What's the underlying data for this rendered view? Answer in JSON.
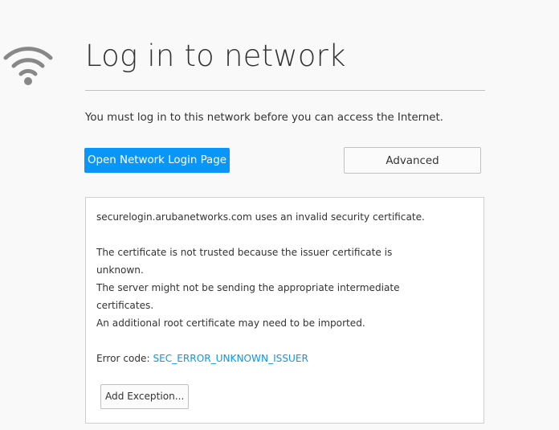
{
  "page": {
    "title": "Log in to network",
    "description": "You must log in to this network before you can access the Internet.",
    "icon": "wifi-icon"
  },
  "actions": {
    "primary_label": "Open Network Login Page",
    "secondary_label": "Advanced"
  },
  "details": {
    "invalid_cert": "securelogin.arubanetworks.com uses an invalid security certificate.",
    "not_trusted_1": "The certificate is not trusted because the issuer certificate is",
    "not_trusted_2": "unknown.",
    "intermediate_1": "The server might not be sending the appropriate intermediate",
    "intermediate_2": "certificates.",
    "root_cert": "An additional root certificate may need to be imported.",
    "error_code_label": "Error code:",
    "error_code": "SEC_ERROR_UNKNOWN_ISSUER",
    "add_exception_label": "Add Exception..."
  },
  "colors": {
    "accent": "#0996f8",
    "text": "#333333",
    "background": "#f9f9f9"
  }
}
